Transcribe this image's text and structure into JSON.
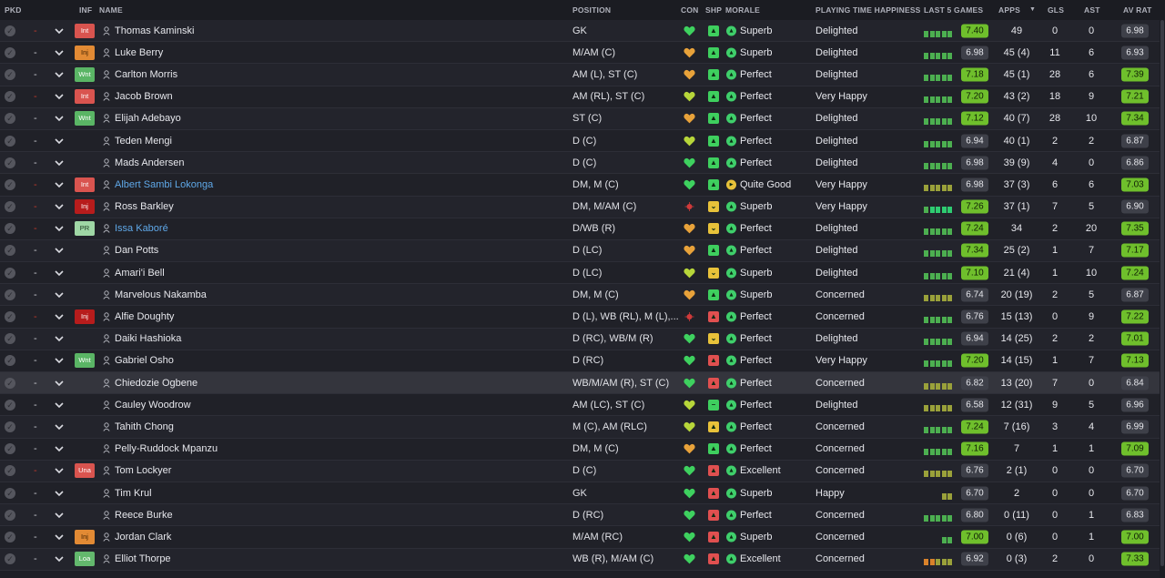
{
  "colors": {
    "green_rating": "#6fbf2c",
    "neutral_rating": "#3e4049",
    "inf_int": "#d9544f",
    "inf_inj": "#e28a34",
    "inf_wnt": "#5ab565",
    "morale_green": "#3fcf6b",
    "shp_green": "#3ecf5e"
  },
  "header": {
    "pkd": "PKD",
    "inf": "INF",
    "name": "NAME",
    "position": "POSITION",
    "con": "CON",
    "shp": "SHP",
    "morale": "MORALE",
    "playing_time": "PLAYING TIME HAPPINESS",
    "last5": "LAST 5 GAMES",
    "apps": "APPS",
    "gls": "GLS",
    "ast": "AST",
    "avrat": "AV RAT",
    "sort_icon": "sort-down-icon"
  },
  "players": [
    {
      "dash": "-",
      "dash_red": true,
      "inf": "Int",
      "inf_type": "int",
      "name": "Thomas Kaminski",
      "blue": false,
      "position": "GK",
      "con": "green",
      "shp": "green",
      "shp_icon": "up",
      "morale_color": "#3fcf6b",
      "morale": "Superb",
      "pth": "Delighted",
      "l5": [
        "g",
        "g",
        "g",
        "g",
        "g"
      ],
      "l5_rating": "7.40",
      "l5_hi": true,
      "apps": "49",
      "gls": "0",
      "ast": "0",
      "avrat": "6.98",
      "av_hi": false
    },
    {
      "dash": "-",
      "dash_red": false,
      "inf": "Inj",
      "inf_type": "inj",
      "name": "Luke Berry",
      "blue": false,
      "position": "M/AM (C)",
      "con": "orange",
      "shp": "green",
      "shp_icon": "up",
      "morale_color": "#3fcf6b",
      "morale": "Superb",
      "pth": "Delighted",
      "l5": [
        "g",
        "g",
        "g",
        "g",
        "g"
      ],
      "l5_rating": "6.98",
      "l5_hi": false,
      "apps": "45 (4)",
      "gls": "11",
      "ast": "6",
      "avrat": "6.93",
      "av_hi": false
    },
    {
      "dash": "-",
      "dash_red": false,
      "inf": "Wnt",
      "inf_type": "wnt",
      "name": "Carlton Morris",
      "blue": false,
      "position": "AM (L), ST (C)",
      "con": "orange",
      "shp": "green",
      "shp_icon": "up",
      "morale_color": "#3fcf6b",
      "morale": "Perfect",
      "pth": "Delighted",
      "l5": [
        "g",
        "g",
        "g",
        "g",
        "g"
      ],
      "l5_rating": "7.18",
      "l5_hi": true,
      "apps": "45 (1)",
      "gls": "28",
      "ast": "6",
      "avrat": "7.39",
      "av_hi": true
    },
    {
      "dash": "-",
      "dash_red": true,
      "inf": "Int",
      "inf_type": "int",
      "name": "Jacob Brown",
      "blue": false,
      "position": "AM (RL), ST (C)",
      "con": "yellowgreen",
      "shp": "green",
      "shp_icon": "up",
      "morale_color": "#3fcf6b",
      "morale": "Perfect",
      "pth": "Very Happy",
      "l5": [
        "g",
        "g",
        "g",
        "g",
        "g"
      ],
      "l5_rating": "7.20",
      "l5_hi": true,
      "apps": "43 (2)",
      "gls": "18",
      "ast": "9",
      "avrat": "7.21",
      "av_hi": true
    },
    {
      "dash": "-",
      "dash_red": false,
      "inf": "Wnt",
      "inf_type": "wnt",
      "name": "Elijah Adebayo",
      "blue": false,
      "position": "ST (C)",
      "con": "orange",
      "shp": "green",
      "shp_icon": "up",
      "morale_color": "#3fcf6b",
      "morale": "Perfect",
      "pth": "Delighted",
      "l5": [
        "g",
        "g",
        "g",
        "g",
        "g"
      ],
      "l5_rating": "7.12",
      "l5_hi": true,
      "apps": "40 (7)",
      "gls": "28",
      "ast": "10",
      "avrat": "7.34",
      "av_hi": true
    },
    {
      "dash": "-",
      "dash_red": false,
      "inf": "",
      "inf_type": "",
      "name": "Teden Mengi",
      "blue": false,
      "position": "D (C)",
      "con": "yellowgreen",
      "shp": "green",
      "shp_icon": "up",
      "morale_color": "#3fcf6b",
      "morale": "Perfect",
      "pth": "Delighted",
      "l5": [
        "g",
        "g",
        "g",
        "g",
        "g"
      ],
      "l5_rating": "6.94",
      "l5_hi": false,
      "apps": "40 (1)",
      "gls": "2",
      "ast": "2",
      "avrat": "6.87",
      "av_hi": false
    },
    {
      "dash": "-",
      "dash_red": false,
      "inf": "",
      "inf_type": "",
      "name": "Mads Andersen",
      "blue": false,
      "position": "D (C)",
      "con": "green",
      "shp": "green",
      "shp_icon": "up",
      "morale_color": "#3fcf6b",
      "morale": "Perfect",
      "pth": "Delighted",
      "l5": [
        "g",
        "g",
        "g",
        "g",
        "g"
      ],
      "l5_rating": "6.98",
      "l5_hi": false,
      "apps": "39 (9)",
      "gls": "4",
      "ast": "0",
      "avrat": "6.86",
      "av_hi": false
    },
    {
      "dash": "-",
      "dash_red": true,
      "inf": "Int",
      "inf_type": "int",
      "name": "Albert Sambi Lokonga",
      "blue": true,
      "position": "DM, M (C)",
      "con": "green",
      "shp": "green",
      "shp_icon": "up",
      "morale_color": "#e8c23a",
      "morale": "Quite Good",
      "pth": "Very Happy",
      "l5": [
        "y",
        "y",
        "y",
        "y",
        "y"
      ],
      "l5_rating": "6.98",
      "l5_hi": false,
      "apps": "37 (3)",
      "gls": "6",
      "ast": "6",
      "avrat": "7.03",
      "av_hi": true
    },
    {
      "dash": "-",
      "dash_red": true,
      "inf": "Inj",
      "inf_type": "injr",
      "name": "Ross Barkley",
      "blue": false,
      "position": "DM, M/AM (C)",
      "con": "red",
      "shp": "yellow",
      "shp_icon": "down",
      "morale_color": "#3fcf6b",
      "morale": "Superb",
      "pth": "Very Happy",
      "l5": [
        "g",
        "gr",
        "gr",
        "gr",
        "gr"
      ],
      "l5_rating": "7.26",
      "l5_hi": true,
      "apps": "37 (1)",
      "gls": "7",
      "ast": "5",
      "avrat": "6.90",
      "av_hi": false
    },
    {
      "dash": "-",
      "dash_red": true,
      "inf": "PR",
      "inf_type": "pr",
      "name": "Issa Kaboré",
      "blue": true,
      "position": "D/WB (R)",
      "con": "orange",
      "shp": "yellow",
      "shp_icon": "down",
      "morale_color": "#3fcf6b",
      "morale": "Perfect",
      "pth": "Delighted",
      "l5": [
        "g",
        "g",
        "g",
        "g",
        "g"
      ],
      "l5_rating": "7.24",
      "l5_hi": true,
      "apps": "34",
      "gls": "2",
      "ast": "20",
      "avrat": "7.35",
      "av_hi": true
    },
    {
      "dash": "-",
      "dash_red": false,
      "inf": "",
      "inf_type": "",
      "name": "Dan Potts",
      "blue": false,
      "position": "D (LC)",
      "con": "orange",
      "shp": "green",
      "shp_icon": "up",
      "morale_color": "#3fcf6b",
      "morale": "Perfect",
      "pth": "Delighted",
      "l5": [
        "g",
        "g",
        "g",
        "g",
        "g"
      ],
      "l5_rating": "7.34",
      "l5_hi": true,
      "apps": "25 (2)",
      "gls": "1",
      "ast": "7",
      "avrat": "7.17",
      "av_hi": true
    },
    {
      "dash": "-",
      "dash_red": false,
      "inf": "",
      "inf_type": "",
      "name": "Amari'i Bell",
      "blue": false,
      "position": "D (LC)",
      "con": "yellowgreen",
      "shp": "yellow",
      "shp_icon": "down",
      "morale_color": "#3fcf6b",
      "morale": "Superb",
      "pth": "Delighted",
      "l5": [
        "g",
        "g",
        "g",
        "g",
        "g"
      ],
      "l5_rating": "7.10",
      "l5_hi": true,
      "apps": "21 (4)",
      "gls": "1",
      "ast": "10",
      "avrat": "7.24",
      "av_hi": true
    },
    {
      "dash": "-",
      "dash_red": false,
      "inf": "",
      "inf_type": "",
      "name": "Marvelous Nakamba",
      "blue": false,
      "position": "DM, M (C)",
      "con": "orange",
      "shp": "green",
      "shp_icon": "up",
      "morale_color": "#3fcf6b",
      "morale": "Superb",
      "pth": "Concerned",
      "l5": [
        "y",
        "y",
        "y",
        "y",
        "y"
      ],
      "l5_rating": "6.74",
      "l5_hi": false,
      "apps": "20 (19)",
      "gls": "2",
      "ast": "5",
      "avrat": "6.87",
      "av_hi": false
    },
    {
      "dash": "-",
      "dash_red": true,
      "inf": "Inj",
      "inf_type": "injr",
      "name": "Alfie Doughty",
      "blue": false,
      "position": "D (L), WB (RL), M (L),...",
      "con": "red",
      "shp": "red",
      "shp_icon": "up",
      "morale_color": "#3fcf6b",
      "morale": "Perfect",
      "pth": "Concerned",
      "l5": [
        "g",
        "g",
        "g",
        "g",
        "g"
      ],
      "l5_rating": "6.76",
      "l5_hi": false,
      "apps": "15 (13)",
      "gls": "0",
      "ast": "9",
      "avrat": "7.22",
      "av_hi": true
    },
    {
      "dash": "-",
      "dash_red": false,
      "inf": "",
      "inf_type": "",
      "name": "Daiki Hashioka",
      "blue": false,
      "position": "D (RC), WB/M (R)",
      "con": "green",
      "shp": "yellow",
      "shp_icon": "down",
      "morale_color": "#3fcf6b",
      "morale": "Perfect",
      "pth": "Delighted",
      "l5": [
        "g",
        "g",
        "g",
        "g",
        "g"
      ],
      "l5_rating": "6.94",
      "l5_hi": false,
      "apps": "14 (25)",
      "gls": "2",
      "ast": "2",
      "avrat": "7.01",
      "av_hi": true
    },
    {
      "dash": "-",
      "dash_red": false,
      "inf": "Wnt",
      "inf_type": "wnt",
      "name": "Gabriel Osho",
      "blue": false,
      "position": "D (RC)",
      "con": "green",
      "shp": "red",
      "shp_icon": "up",
      "morale_color": "#3fcf6b",
      "morale": "Perfect",
      "pth": "Very Happy",
      "l5": [
        "g",
        "g",
        "g",
        "g",
        "g"
      ],
      "l5_rating": "7.20",
      "l5_hi": true,
      "apps": "14 (15)",
      "gls": "1",
      "ast": "7",
      "avrat": "7.13",
      "av_hi": true
    },
    {
      "dash": "-",
      "dash_red": false,
      "inf": "",
      "inf_type": "",
      "name": "Chiedozie Ogbene",
      "blue": false,
      "position": "WB/M/AM (R), ST (C)",
      "con": "green",
      "shp": "red",
      "shp_icon": "up",
      "morale_color": "#3fcf6b",
      "morale": "Perfect",
      "pth": "Concerned",
      "l5": [
        "y",
        "y",
        "y",
        "y",
        "y"
      ],
      "l5_rating": "6.82",
      "l5_hi": false,
      "apps": "13 (20)",
      "gls": "7",
      "ast": "0",
      "avrat": "6.84",
      "av_hi": false,
      "selected": true
    },
    {
      "dash": "-",
      "dash_red": false,
      "inf": "",
      "inf_type": "",
      "name": "Cauley Woodrow",
      "blue": false,
      "position": "AM (LC), ST (C)",
      "con": "yellowgreen",
      "shp": "green",
      "shp_icon": "flat",
      "morale_color": "#3fcf6b",
      "morale": "Perfect",
      "pth": "Delighted",
      "l5": [
        "y",
        "y",
        "y",
        "y",
        "y"
      ],
      "l5_rating": "6.58",
      "l5_hi": false,
      "apps": "12 (31)",
      "gls": "9",
      "ast": "5",
      "avrat": "6.96",
      "av_hi": false
    },
    {
      "dash": "-",
      "dash_red": false,
      "inf": "",
      "inf_type": "",
      "name": "Tahith Chong",
      "blue": false,
      "position": "M (C), AM (RLC)",
      "con": "yellowgreen",
      "shp": "yellow",
      "shp_icon": "up",
      "morale_color": "#3fcf6b",
      "morale": "Perfect",
      "pth": "Concerned",
      "l5": [
        "g",
        "g",
        "g",
        "g",
        "g"
      ],
      "l5_rating": "7.24",
      "l5_hi": true,
      "apps": "7 (16)",
      "gls": "3",
      "ast": "4",
      "avrat": "6.99",
      "av_hi": false
    },
    {
      "dash": "-",
      "dash_red": false,
      "inf": "",
      "inf_type": "",
      "name": "Pelly-Ruddock Mpanzu",
      "blue": false,
      "position": "DM, M (C)",
      "con": "orange",
      "shp": "green",
      "shp_icon": "up",
      "morale_color": "#3fcf6b",
      "morale": "Perfect",
      "pth": "Concerned",
      "l5": [
        "g",
        "g",
        "g",
        "g",
        "g"
      ],
      "l5_rating": "7.16",
      "l5_hi": true,
      "apps": "7",
      "gls": "1",
      "ast": "1",
      "avrat": "7.09",
      "av_hi": true
    },
    {
      "dash": "-",
      "dash_red": true,
      "inf": "Una",
      "inf_type": "una",
      "name": "Tom Lockyer",
      "blue": false,
      "position": "D (C)",
      "con": "green",
      "shp": "red",
      "shp_icon": "up",
      "morale_color": "#3fcf6b",
      "morale": "Excellent",
      "pth": "Concerned",
      "l5": [
        "y",
        "y",
        "y",
        "y",
        "y"
      ],
      "l5_rating": "6.76",
      "l5_hi": false,
      "apps": "2 (1)",
      "gls": "0",
      "ast": "0",
      "avrat": "6.70",
      "av_hi": false
    },
    {
      "dash": "-",
      "dash_red": false,
      "inf": "",
      "inf_type": "",
      "name": "Tim Krul",
      "blue": false,
      "position": "GK",
      "con": "green",
      "shp": "red",
      "shp_icon": "up",
      "morale_color": "#3fcf6b",
      "morale": "Superb",
      "pth": "Happy",
      "l5": [
        "",
        "",
        "",
        "y",
        "y"
      ],
      "l5_rating": "6.70",
      "l5_hi": false,
      "apps": "2",
      "gls": "0",
      "ast": "0",
      "avrat": "6.70",
      "av_hi": false
    },
    {
      "dash": "-",
      "dash_red": false,
      "inf": "",
      "inf_type": "",
      "name": "Reece Burke",
      "blue": false,
      "position": "D (RC)",
      "con": "green",
      "shp": "red",
      "shp_icon": "up",
      "morale_color": "#3fcf6b",
      "morale": "Perfect",
      "pth": "Concerned",
      "l5": [
        "g",
        "g",
        "g",
        "g",
        "g"
      ],
      "l5_rating": "6.80",
      "l5_hi": false,
      "apps": "0 (11)",
      "gls": "0",
      "ast": "1",
      "avrat": "6.83",
      "av_hi": false
    },
    {
      "dash": "-",
      "dash_red": false,
      "inf": "Inj",
      "inf_type": "inj",
      "name": "Jordan Clark",
      "blue": false,
      "position": "M/AM (RC)",
      "con": "green",
      "shp": "red",
      "shp_icon": "up",
      "morale_color": "#3fcf6b",
      "morale": "Superb",
      "pth": "Concerned",
      "l5": [
        "",
        "",
        "",
        "g",
        "g"
      ],
      "l5_rating": "7.00",
      "l5_hi": true,
      "apps": "0 (6)",
      "gls": "0",
      "ast": "1",
      "avrat": "7.00",
      "av_hi": true
    },
    {
      "dash": "-",
      "dash_red": false,
      "inf": "Loa",
      "inf_type": "loa",
      "name": "Elliot Thorpe",
      "blue": false,
      "position": "WB (R), M/AM (C)",
      "con": "green",
      "shp": "red",
      "shp_icon": "up",
      "morale_color": "#3fcf6b",
      "morale": "Excellent",
      "pth": "Concerned",
      "l5": [
        "o",
        "o",
        "y",
        "y",
        "y"
      ],
      "l5_rating": "6.92",
      "l5_hi": false,
      "apps": "0 (3)",
      "gls": "2",
      "ast": "0",
      "avrat": "7.33",
      "av_hi": true
    }
  ]
}
